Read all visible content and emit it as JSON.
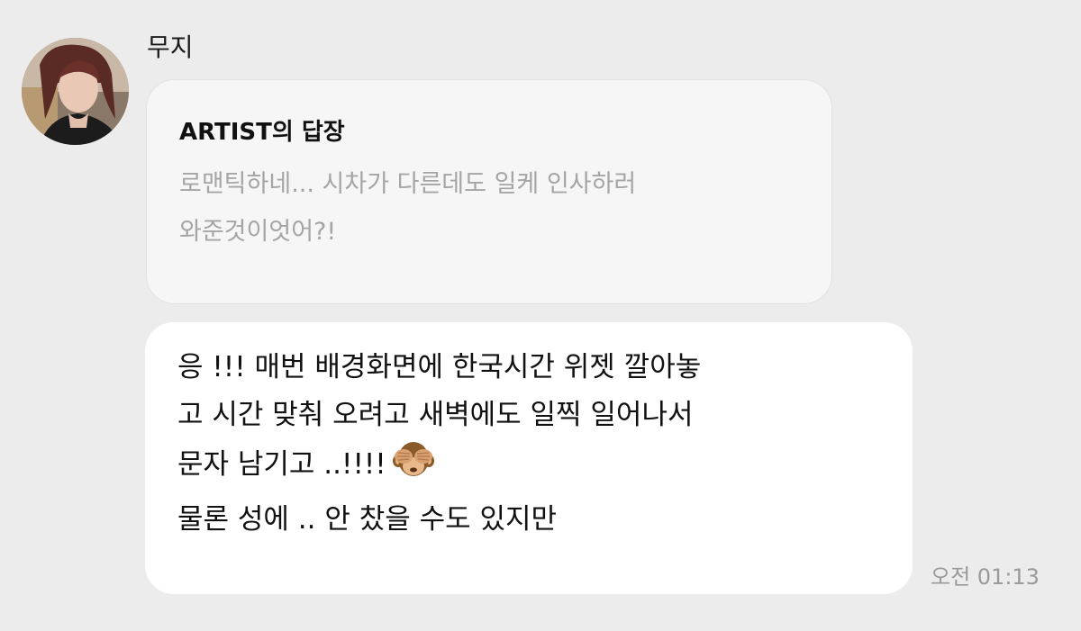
{
  "sender": {
    "name": "무지"
  },
  "quote": {
    "title": "ARTIST의 답장",
    "lines": [
      "로맨틱하네... 시차가 다른데도 일케 인사하러",
      "와준것이엇어?!"
    ]
  },
  "message": {
    "lines": [
      "응 !!! 매번 배경화면에 한국시간 위젯 깔아놓",
      "고 시간 맞춰 오려고 새벽에도 일찍 일어나서",
      "문자 남기고 ..!!!!",
      "물론 성에 .. 안 찼을 수도 있지만"
    ],
    "emoji": "see-no-evil-monkey-icon",
    "timestamp": "오전 01:13"
  },
  "colors": {
    "background": "#ececec",
    "quote_bubble": "#f6f6f6",
    "message_bubble": "#ffffff",
    "quote_text": "#a5a5a5",
    "timestamp": "#9a9a9a"
  }
}
